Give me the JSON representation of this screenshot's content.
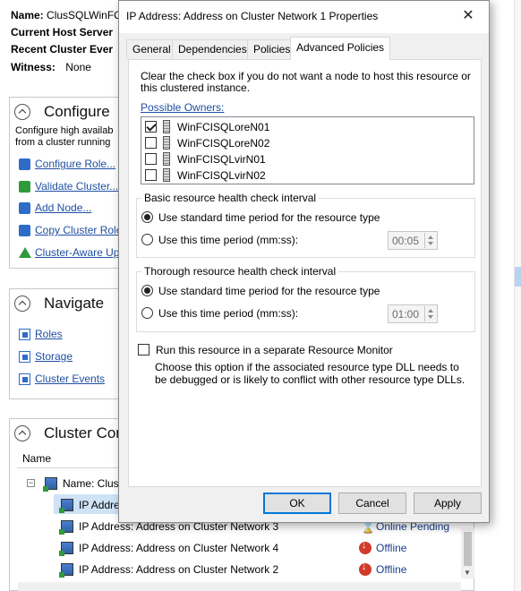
{
  "background": {
    "summary": [
      {
        "label": "Name:",
        "value": "ClusSQLWinFC"
      },
      {
        "label": "Current Host Server",
        "value": ""
      },
      {
        "label": "Recent Cluster Ever",
        "value": ""
      },
      {
        "label": "Witness:",
        "value": "None"
      }
    ],
    "configure": {
      "title": "Configure",
      "desc_line1": "Configure high availab",
      "desc_line2": "from a cluster running",
      "actions": [
        "Configure Role...",
        "Validate Cluster...",
        "Add Node...",
        "Copy Cluster Roles",
        "Cluster-Aware Upd"
      ]
    },
    "navigate": {
      "title": "Navigate",
      "links": [
        "Roles",
        "Storage",
        "Cluster Events"
      ]
    },
    "core": {
      "title": "Cluster Cor",
      "column_name": "Name",
      "root_name": "Name: ClusS",
      "selected_partial": "IP Addre",
      "rows": [
        {
          "name": "IP Address: Address on Cluster Network 3",
          "status": "Online Pending",
          "status_icon": "hourglass-icon"
        },
        {
          "name": "IP Address: Address on Cluster Network 4",
          "status": "Offline",
          "status_icon": "offline-icon"
        },
        {
          "name": "IP Address: Address on Cluster Network 2",
          "status": "Offline",
          "status_icon": "offline-icon"
        }
      ]
    }
  },
  "dialog": {
    "title": "IP Address: Address on Cluster Network 1 Properties",
    "close_glyph": "✕",
    "tabs": [
      "General",
      "Dependencies",
      "Policies",
      "Advanced Policies"
    ],
    "active_tab": "Advanced Policies",
    "intro": "Clear the check box if you do not want a node to host this resource or this clustered instance.",
    "possible_owners_label": "Possible Owners:",
    "owners": [
      {
        "name": "WinFCISQLoreN01",
        "checked": true
      },
      {
        "name": "WinFCISQLoreN02",
        "checked": false
      },
      {
        "name": "WinFCISQLvirN01",
        "checked": false
      },
      {
        "name": "WinFCISQLvirN02",
        "checked": false
      }
    ],
    "basic_check": {
      "title": "Basic resource health check interval",
      "option_standard": "Use standard time period for the resource type",
      "option_custom": "Use this time period (mm:ss):",
      "selected": "standard",
      "value": "00:05"
    },
    "thorough_check": {
      "title": "Thorough resource health check interval",
      "option_standard": "Use standard time period for the resource type",
      "option_custom": "Use this time period (mm:ss):",
      "selected": "standard",
      "value": "01:00"
    },
    "separate_monitor": {
      "label": "Run this resource in a separate Resource Monitor",
      "checked": false,
      "description": "Choose this option if the associated resource type DLL needs to be debugged or is likely to conflict with other resource type DLLs."
    },
    "buttons": {
      "ok": "OK",
      "cancel": "Cancel",
      "apply": "Apply"
    }
  }
}
